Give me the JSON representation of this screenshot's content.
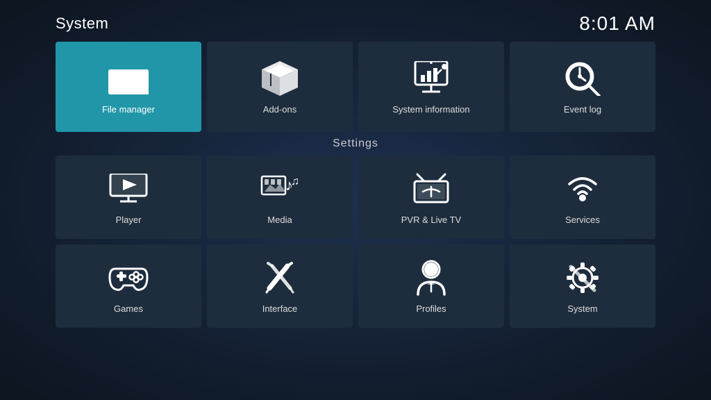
{
  "header": {
    "title": "System",
    "time": "8:01 AM"
  },
  "top_tiles": [
    {
      "id": "file-manager",
      "label": "File manager",
      "active": true
    },
    {
      "id": "add-ons",
      "label": "Add-ons",
      "active": false
    },
    {
      "id": "system-information",
      "label": "System information",
      "active": false
    },
    {
      "id": "event-log",
      "label": "Event log",
      "active": false
    }
  ],
  "settings": {
    "title": "Settings",
    "tiles": [
      {
        "id": "player",
        "label": "Player"
      },
      {
        "id": "media",
        "label": "Media"
      },
      {
        "id": "pvr-live-tv",
        "label": "PVR & Live TV"
      },
      {
        "id": "services",
        "label": "Services"
      },
      {
        "id": "games",
        "label": "Games"
      },
      {
        "id": "interface",
        "label": "Interface"
      },
      {
        "id": "profiles",
        "label": "Profiles"
      },
      {
        "id": "system",
        "label": "System"
      }
    ]
  }
}
